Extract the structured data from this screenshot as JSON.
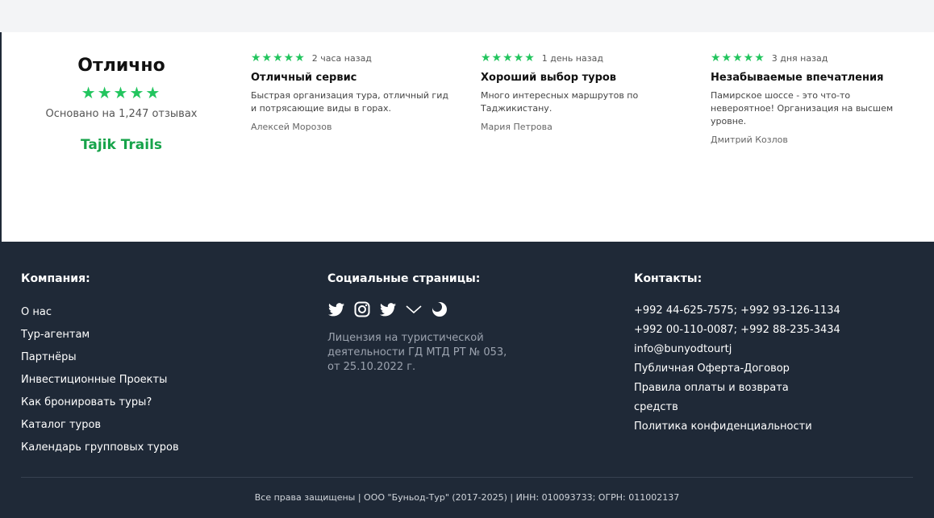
{
  "summary": {
    "title": "Отлично",
    "stars": "★★★★★",
    "based_on": "Основано на 1,247 отзывах",
    "brand": "Tajik Trails"
  },
  "reviews": [
    {
      "stars": "★★★★★",
      "time": "2 часа назад",
      "title": "Отличный сервис",
      "text": "Быстрая организация тура, отличный гид и потрясающие виды в горах.",
      "author": "Алексей Морозов"
    },
    {
      "stars": "★★★★★",
      "time": "1 день назад",
      "title": "Хороший выбор туров",
      "text": "Много интересных маршрутов по Таджикистану.",
      "author": "Мария Петрова"
    },
    {
      "stars": "★★★★★",
      "time": "3 дня назад",
      "title": "Незабываемые впечатления",
      "text": "Памирское шоссе - это что-то невероятное! Организация на высшем уровне.",
      "author": "Дмитрий Козлов"
    }
  ],
  "footer": {
    "company": {
      "heading": "Компания:",
      "links": [
        "О нас",
        "Тур-агентам",
        "Партнёры",
        "Инвестиционные Проекты",
        "Как бронировать туры?",
        "Каталог туров",
        "Календарь групповых туров"
      ]
    },
    "social": {
      "heading": "Социальные страницы:",
      "icons": [
        "twitter-icon",
        "instagram-icon",
        "twitter-icon",
        "vk-icon",
        "moon-icon"
      ],
      "license": "Лицензия на туристической деятельности ГД МТД РТ № 053, от 25.10.2022 г."
    },
    "contacts": {
      "heading": "Контакты:",
      "items": [
        "+992 44-625-7575; +992 93-126-1134",
        "+992 00-110-0087; +992 88-235-3434",
        "info@bunyodtourtj",
        "Публичная Оферта-Договор",
        "Правила оплаты и возврата средств",
        "Политика конфиденциальности"
      ]
    },
    "copyright": "Все права защищены | ООО \"Буньод-Тур\" (2017-2025) | ИНН: 010093733; ОГРН: 011002137"
  },
  "colors": {
    "star": "#22c55e",
    "brand": "#16a34a",
    "footer_bg": "#1f2937",
    "top_band": "#f3f4f6"
  }
}
